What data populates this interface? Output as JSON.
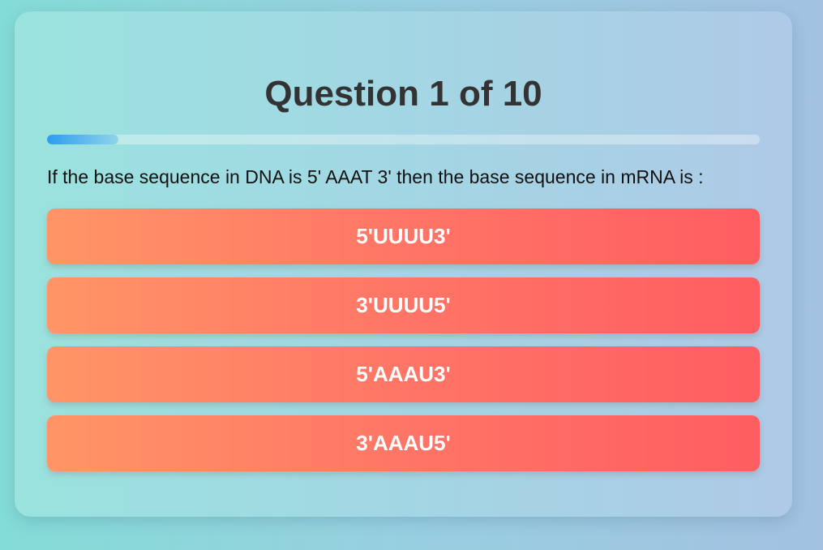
{
  "quiz": {
    "title": "Question 1 of 10",
    "progress": 0.1,
    "question": "If the base sequence in DNA is 5' AAAT 3' then the base sequence in mRNA is :",
    "options": [
      {
        "label": "5'UUUU3'"
      },
      {
        "label": "3'UUUU5'"
      },
      {
        "label": "5'AAAU3'"
      },
      {
        "label": "3'AAAU5'"
      }
    ]
  },
  "colors": {
    "title": "#333333",
    "progress_fill": "#2d9cf0",
    "option_start": "#ff9566",
    "option_end": "#ff5d61",
    "option_text": "#ffffff"
  }
}
